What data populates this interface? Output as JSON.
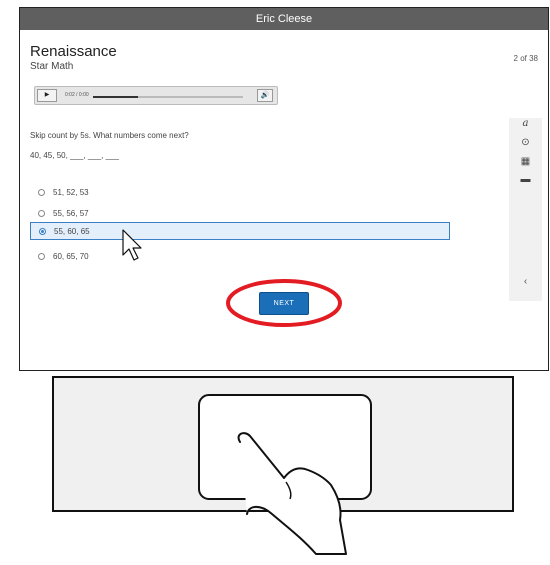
{
  "window": {
    "title": "Eric Cleese"
  },
  "header": {
    "brand": "Renaissance",
    "product": "Star Math",
    "counter": "2 of 38"
  },
  "audio": {
    "play_icon": "play-icon",
    "play_glyph": "▶",
    "time": "0:02 / 0:00",
    "progress_fraction": 0.3,
    "volume_icon": "speaker-icon",
    "volume_glyph": "🔊"
  },
  "question": {
    "prompt": "Skip count by 5s. What numbers come next?",
    "sequence": "40, 45, 50, ___, ___, ___"
  },
  "choices": [
    {
      "label": "51, 52, 53",
      "selected": false
    },
    {
      "label": "55, 56, 57",
      "selected": false
    },
    {
      "label": "55, 60, 65",
      "selected": true
    },
    {
      "label": "60, 65, 70",
      "selected": false
    }
  ],
  "sidebar": {
    "tools": [
      {
        "icon": "text-size-icon",
        "glyph": "a"
      },
      {
        "icon": "accessibility-icon",
        "glyph": "⊙"
      },
      {
        "icon": "calculator-icon",
        "glyph": "▦"
      },
      {
        "icon": "line-reader-icon",
        "glyph": "▬"
      }
    ],
    "collapse_glyph": "‹"
  },
  "actions": {
    "next_label": "NEXT"
  },
  "colors": {
    "accent": "#1a6fb8",
    "highlight": "#e31b23",
    "selected_bg": "#e3f0fb",
    "titlebar": "#5f5f5f"
  }
}
